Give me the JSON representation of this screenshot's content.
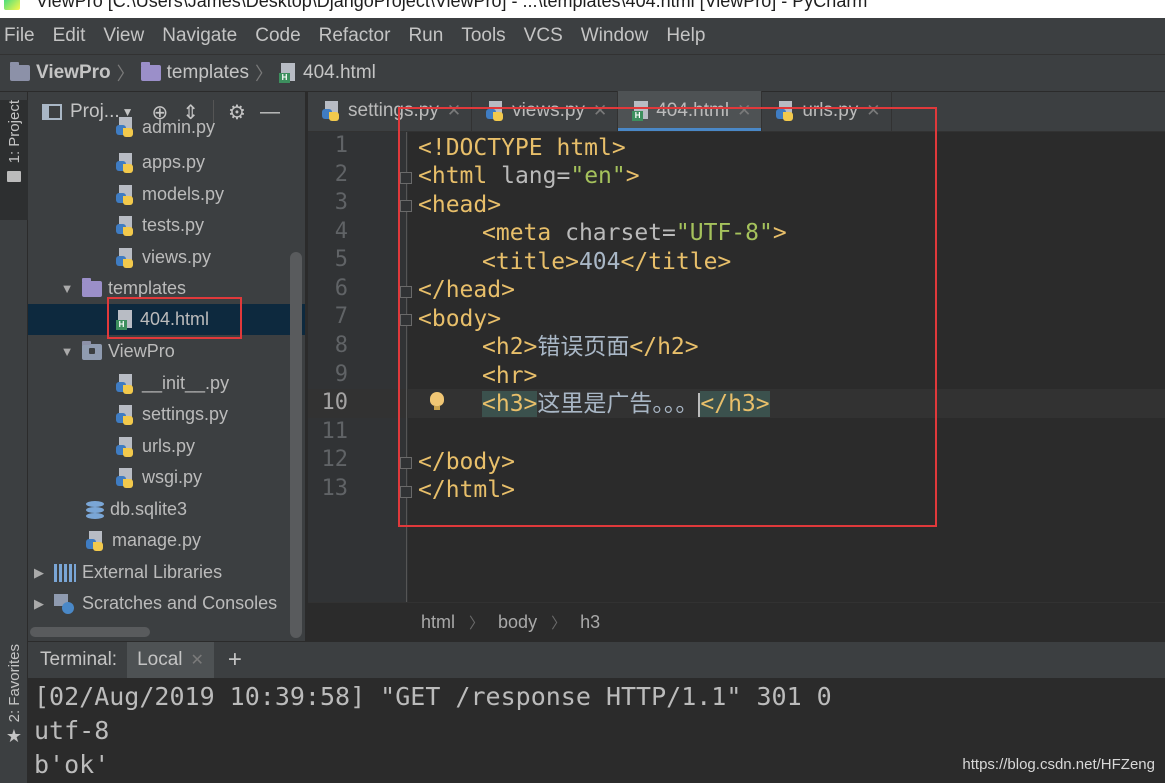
{
  "window": {
    "title": "ViewPro [C:\\Users\\James\\Desktop\\DjangoProject\\ViewPro] - ...\\templates\\404.html [ViewPro] - PyCharm"
  },
  "menu": [
    "File",
    "Edit",
    "View",
    "Navigate",
    "Code",
    "Refactor",
    "Run",
    "Tools",
    "VCS",
    "Window",
    "Help"
  ],
  "navbar": {
    "project": "ViewPro",
    "folder": "templates",
    "file": "404.html"
  },
  "sidestrip": {
    "project_tab": "1: Project",
    "favorites_tab": "2: Favorites"
  },
  "project_panel": {
    "title": "Proj...",
    "items": [
      {
        "label": "admin.py",
        "icon": "python-file-icon"
      },
      {
        "label": "apps.py",
        "icon": "python-file-icon"
      },
      {
        "label": "models.py",
        "icon": "python-file-icon"
      },
      {
        "label": "tests.py",
        "icon": "python-file-icon"
      },
      {
        "label": "views.py",
        "icon": "python-file-icon"
      },
      {
        "label": "templates",
        "icon": "folder-icon"
      },
      {
        "label": "404.html",
        "icon": "html-file-icon"
      },
      {
        "label": "ViewPro",
        "icon": "module-folder-icon"
      },
      {
        "label": "__init__.py",
        "icon": "python-file-icon"
      },
      {
        "label": "settings.py",
        "icon": "python-file-icon"
      },
      {
        "label": "urls.py",
        "icon": "python-file-icon"
      },
      {
        "label": "wsgi.py",
        "icon": "python-file-icon"
      },
      {
        "label": "db.sqlite3",
        "icon": "database-icon"
      },
      {
        "label": "manage.py",
        "icon": "python-file-icon"
      },
      {
        "label": "External Libraries",
        "icon": "libraries-icon"
      },
      {
        "label": "Scratches and Consoles",
        "icon": "scratches-icon"
      }
    ]
  },
  "editor_tabs": [
    {
      "label": "settings.py",
      "active": false
    },
    {
      "label": "views.py",
      "active": false
    },
    {
      "label": "404.html",
      "active": true
    },
    {
      "label": "urls.py",
      "active": false
    }
  ],
  "editor": {
    "current_line": 10,
    "line_numbers": [
      "1",
      "2",
      "3",
      "4",
      "5",
      "6",
      "7",
      "8",
      "9",
      "10",
      "11",
      "12",
      "13"
    ],
    "code": {
      "l1": "<!DOCTYPE html>",
      "l2_open": "<html ",
      "l2_attr": "lang=",
      "l2_val": "\"en\"",
      "l2_close": ">",
      "l3": "<head>",
      "l4_open": "<meta ",
      "l4_attr": "charset=",
      "l4_val": "\"UTF-8\"",
      "l4_close": ">",
      "l5_open": "<title>",
      "l5_text": "404",
      "l5_close": "</title>",
      "l6": "</head>",
      "l7": "<body>",
      "l8_open": "<h2>",
      "l8_text": "错误页面",
      "l8_close": "</h2>",
      "l9": "<hr>",
      "l10_open": "<h3>",
      "l10_text": "这里是广告。。。",
      "l10_close": "</h3>",
      "l12": "</body>",
      "l13": "</html>"
    }
  },
  "breadcrumb": [
    "html",
    "body",
    "h3"
  ],
  "terminal": {
    "label": "Terminal:",
    "tab": "Local",
    "lines": [
      "[02/Aug/2019 10:39:58] \"GET /response HTTP/1.1\" 301 0",
      "utf-8",
      "b'ok'"
    ]
  },
  "watermark": "https://blog.csdn.net/HFZeng",
  "colors": {
    "tag": "#e8bf6a",
    "string": "#a5c25c",
    "highlight": "#e0393b",
    "background": "#2b2b2b"
  }
}
